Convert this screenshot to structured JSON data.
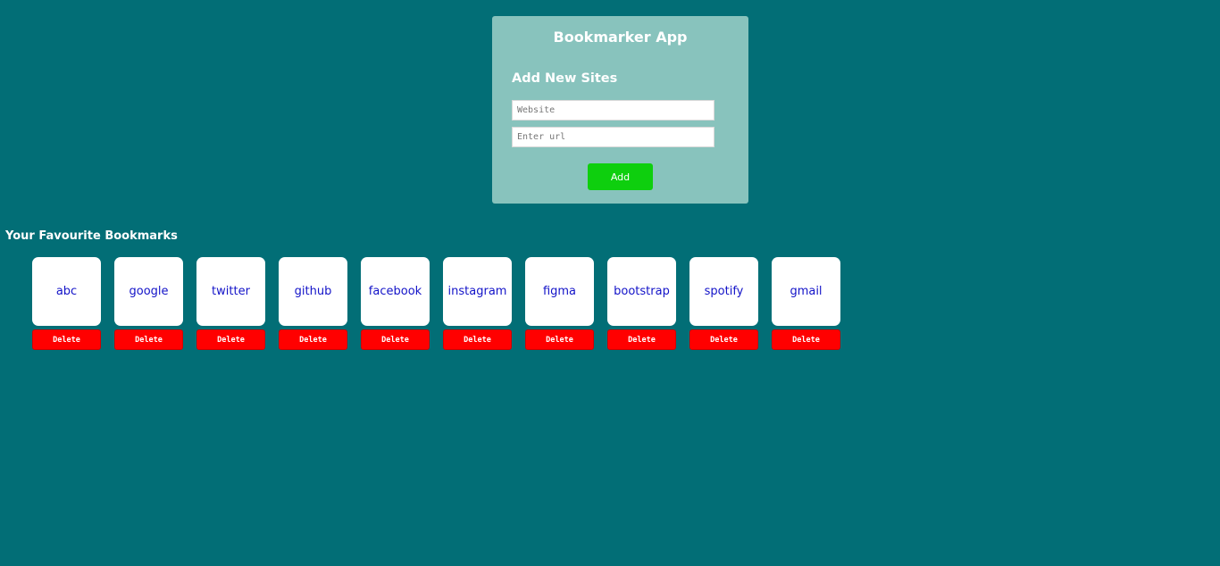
{
  "app": {
    "title": "Bookmarker App"
  },
  "form": {
    "section_title": "Add New Sites",
    "website_placeholder": "Website",
    "url_placeholder": "Enter url",
    "add_label": "Add"
  },
  "bookmarks": {
    "heading": "Your Favourite Bookmarks",
    "delete_label": "Delete",
    "items": [
      {
        "name": "abc"
      },
      {
        "name": "google"
      },
      {
        "name": "twitter"
      },
      {
        "name": "github"
      },
      {
        "name": "facebook"
      },
      {
        "name": "instagram"
      },
      {
        "name": "figma"
      },
      {
        "name": "bootstrap"
      },
      {
        "name": "spotify"
      },
      {
        "name": "gmail"
      }
    ]
  },
  "colors": {
    "background": "#026e76",
    "card": "#88c3bd",
    "add_button": "#0ecf0e",
    "delete_button": "#ff0000",
    "link_text": "#1313c8"
  }
}
